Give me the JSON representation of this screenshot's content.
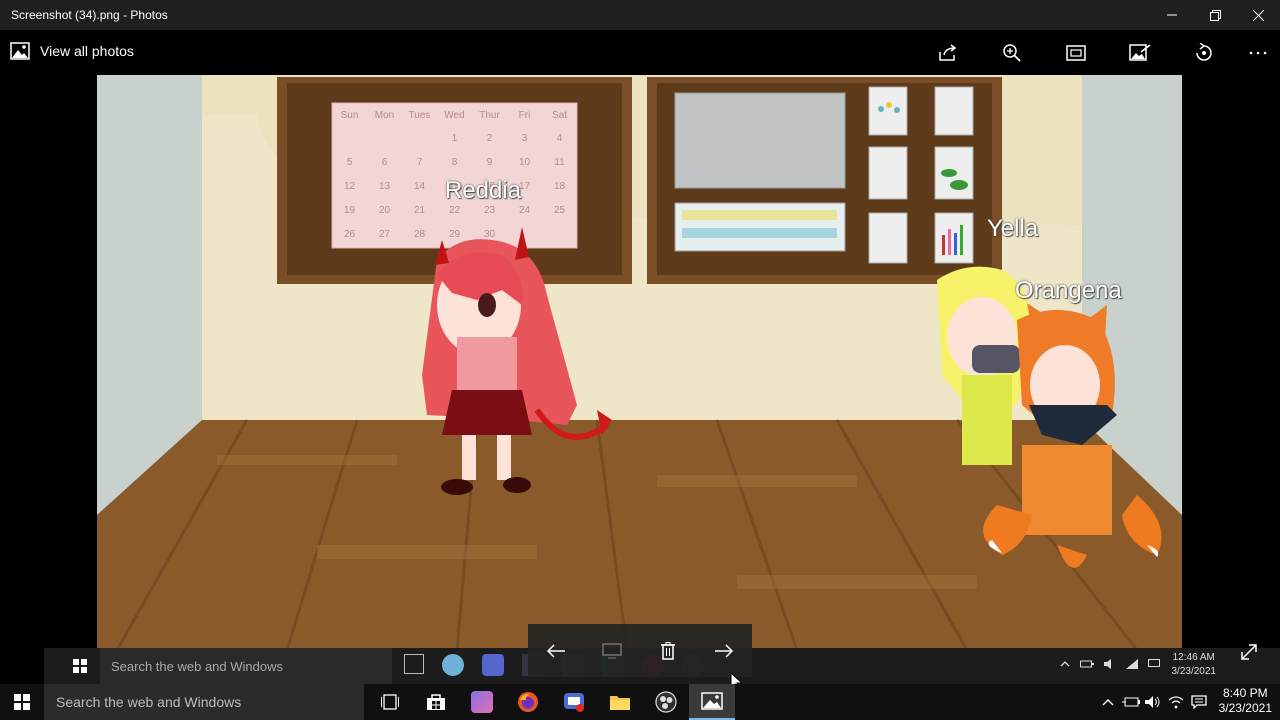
{
  "window": {
    "title": "Screenshot (34).png - Photos"
  },
  "toolbar": {
    "view_all": "View all photos"
  },
  "photo": {
    "calendar": {
      "days": [
        "Sun",
        "Mon",
        "Tues",
        "Wed",
        "Thur",
        "Fri",
        "Sat"
      ],
      "rows": [
        [
          "",
          "",
          "",
          "1",
          "2",
          "3",
          "4"
        ],
        [
          "5",
          "6",
          "7",
          "8",
          "9",
          "10",
          "11"
        ],
        [
          "12",
          "13",
          "14",
          "15",
          "16",
          "17",
          "18"
        ],
        [
          "19",
          "20",
          "21",
          "22",
          "23",
          "24",
          "25"
        ],
        [
          "26",
          "27",
          "28",
          "29",
          "30",
          "",
          ""
        ]
      ]
    },
    "labels": {
      "reddia": "Reddia",
      "yella": "Yella",
      "orangena": "Orangena"
    }
  },
  "inner_taskbar": {
    "search_placeholder": "Search the web and Windows",
    "time": "12:46 AM",
    "date": "3/23/2021"
  },
  "taskbar": {
    "search_placeholder": "Search the web and Windows",
    "time": "8:40 PM",
    "date": "3/23/2021"
  },
  "colors": {
    "accent": "#76b9ed",
    "wall": "#ece2c0",
    "floor": "#8a5a2b",
    "board": "#7a4e26"
  }
}
